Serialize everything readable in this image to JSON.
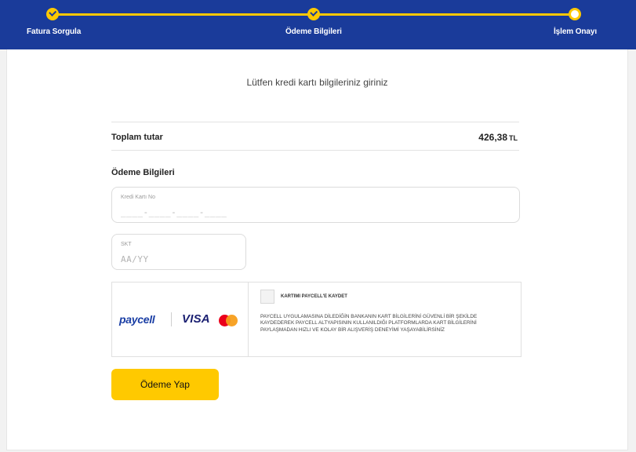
{
  "stepper": {
    "steps": [
      {
        "label": "Fatura Sorgula",
        "status": "done"
      },
      {
        "label": "Ödeme Bilgileri",
        "status": "done"
      },
      {
        "label": "İşlem Onayı",
        "status": "current"
      }
    ]
  },
  "intro": "Lütfen kredi kartı bilgileriniz giriniz",
  "total": {
    "label": "Toplam tutar",
    "amount": "426,38",
    "currency": "TL"
  },
  "payment": {
    "title": "Ödeme Bilgileri",
    "card_number": {
      "label": "Kredi Kartı No",
      "placeholder": "____-____-____-____"
    },
    "expiry": {
      "label": "SKT",
      "placeholder": "AA/YY"
    }
  },
  "paycell": {
    "logo_text": "paycell",
    "visa_text": "VISA",
    "save_label": "KARTIMI PAYCELL'E KAYDET",
    "description": "PAYCELL UYGULAMASINA DİLEDİĞİN BANKANIN KART BİLGİLERİNİ GÜVENLİ BİR ŞEKİLDE KAYDEDEREK PAYCELL ALTYAPISININ KULLANILDIĞI PLATFORMLARDA KART BİLGİLERİNİ PAYLAŞMADAN HIZLI VE KOLAY BİR ALIŞVERİŞ DENEYİMİ YAŞAYABİLİRSİNİZ"
  },
  "pay_button": "Ödeme Yap",
  "colors": {
    "header": "#1a3b9a",
    "accent": "#ffc800",
    "mastercard_red": "#eb001b",
    "mastercard_orange": "#f79e1b"
  }
}
